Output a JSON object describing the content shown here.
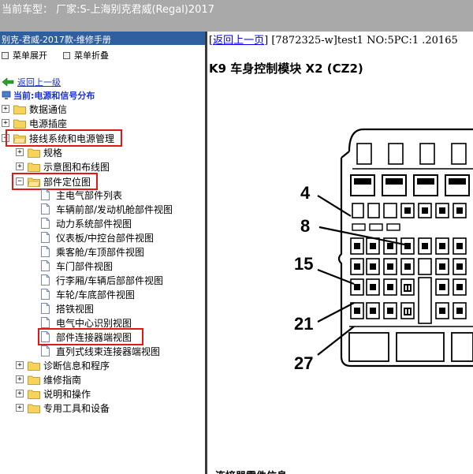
{
  "titlebar": {
    "text": "当前车型：  厂家:S-上海别克君威(Regal)2017"
  },
  "left_pane": {
    "header": "别克-君威-2017款-维修手册",
    "toolbar": {
      "expand": "菜单展开",
      "collapse": "菜单折叠"
    },
    "up_link": "返回上一级",
    "current_label": "当前:电源和信号分布",
    "tree": [
      {
        "id": "data-comm",
        "label": "数据通信",
        "expander": "+",
        "highlighted": false
      },
      {
        "id": "power-outlet",
        "label": "电源插座",
        "expander": "+",
        "highlighted": false
      },
      {
        "id": "wiring-power",
        "label": "接线系统和电源管理",
        "expander": "−",
        "highlighted": true
      },
      {
        "id": "specs",
        "label": "规格",
        "expander": "+",
        "highlighted": false
      },
      {
        "id": "schematics",
        "label": "示意图和布线图",
        "expander": "+",
        "highlighted": false
      },
      {
        "id": "locator",
        "label": "部件定位图",
        "expander": "−",
        "highlighted": true
      },
      {
        "id": "main-parts",
        "label": "主电气部件列表"
      },
      {
        "id": "front-view",
        "label": "车辆前部/发动机舱部件视图"
      },
      {
        "id": "powertrain-view",
        "label": "动力系统部件视图"
      },
      {
        "id": "ip-view",
        "label": "仪表板/中控台部件视图"
      },
      {
        "id": "cabin-view",
        "label": "乘客舱/车顶部件视图"
      },
      {
        "id": "door-view",
        "label": "车门部件视图"
      },
      {
        "id": "trunk-view",
        "label": "行李厢/车辆后部部件视图"
      },
      {
        "id": "wheel-view",
        "label": "车轮/车底部件视图"
      },
      {
        "id": "ground-view",
        "label": "搭铁视图"
      },
      {
        "id": "center-view",
        "label": "电气中心识别视图"
      },
      {
        "id": "connector-end",
        "label": "部件连接器端视图",
        "highlighted": true
      },
      {
        "id": "inline-end",
        "label": "直列式线束连接器端视图"
      },
      {
        "id": "diag",
        "label": "诊断信息和程序",
        "expander": "+"
      },
      {
        "id": "repair",
        "label": "维修指南",
        "expander": "+"
      },
      {
        "id": "description",
        "label": "说明和操作",
        "expander": "+"
      },
      {
        "id": "tools",
        "label": "专用工具和设备",
        "expander": "+"
      }
    ]
  },
  "right_pane": {
    "back_link": "返回上一页",
    "doc_ref": "[7872325-w]test1 NO:5PC:1 .20165",
    "heading": "K9 车身控制模块 X2 (CZ2)",
    "footer_text": "连接器零件信息",
    "diagram_labels": [
      "4",
      "8",
      "15",
      "21",
      "27"
    ]
  },
  "colors": {
    "titlebar": "#a9a9a9",
    "pane_header": "#2f5f9e",
    "highlight_box": "#e01818",
    "link": "#0000ee",
    "splitter": "#3a3a3a"
  }
}
